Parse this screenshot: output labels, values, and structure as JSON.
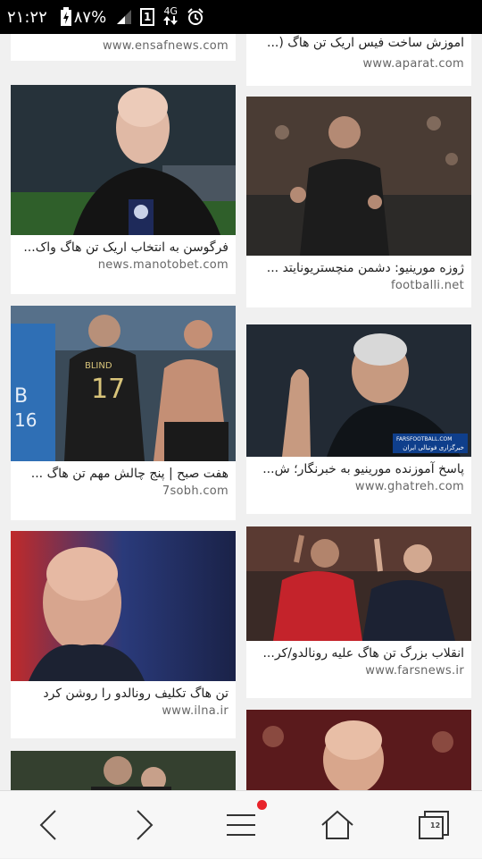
{
  "status_bar": {
    "time": "۲۱:۲۲",
    "battery": "۸۷%",
    "sim_slot": "1",
    "network": "4G"
  },
  "left_column": [
    {
      "title": "",
      "domain": "www.ensafnews.com"
    },
    {
      "title": "فرگوسن به انتخاب اریک تن هاگ واک...",
      "domain": "news.manotobet.com"
    },
    {
      "title": "هفت صبح | پنج چالش مهم تن هاگ ...",
      "domain": "7sobh.com"
    },
    {
      "title": "تن هاگ تکلیف رونالدو را روشن کرد",
      "domain": "www.ilna.ir"
    }
  ],
  "right_column": [
    {
      "title": "اموزش ساخت فیس اریک تن هاگ (...",
      "domain": "www.aparat.com"
    },
    {
      "title": "ژوزه مورینیو: دشمن منچستریونایتد ...",
      "domain": "footballi.net"
    },
    {
      "title": "پاسخ آموزنده مورینیو به خبرنگار؛ ش...",
      "domain": "www.ghatreh.com"
    },
    {
      "title": "انقلاب بزرگ تن هاگ علیه رونالدو/کر...",
      "domain": "www.farsnews.ir"
    }
  ],
  "image_overlay": {
    "shirt_name": "BLIND",
    "shirt_number": "17",
    "side_number": "16",
    "side_letter": "B",
    "watermark_site": "FARSFOOTBALL.COM",
    "watermark_text": "خبرگزاری فوتبالی ایران"
  },
  "bottom_nav": {
    "tabs_count": "12"
  },
  "colors": {
    "accent": "#e8232a",
    "status_bar": "#000000"
  }
}
